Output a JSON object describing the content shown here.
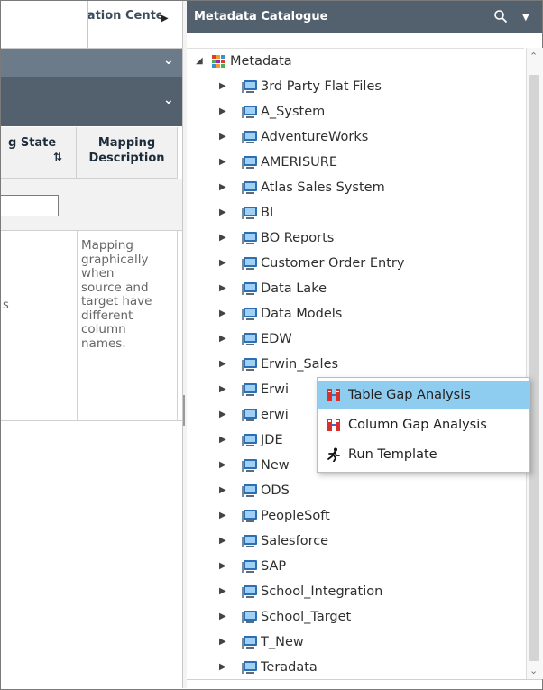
{
  "left_panel": {
    "tab_label": "Collaboration Center",
    "columns": [
      {
        "label_line1": "g State",
        "label_line2": ""
      },
      {
        "label_line1": "Mapping",
        "label_line2": "Description"
      }
    ],
    "row_fragment": "s",
    "row_description_lines": [
      "Mapping",
      "graphically",
      "when",
      "source and",
      "target have",
      "different",
      "column",
      "names."
    ]
  },
  "right_panel": {
    "title": "Metadata Catalogue",
    "root": "Metadata",
    "items": [
      "3rd Party Flat Files",
      "A_System",
      "AdventureWorks",
      "AMERISURE",
      "Atlas Sales System",
      "BI",
      "BO Reports",
      "Customer Order Entry",
      "Data Lake",
      "Data Models",
      "EDW",
      "Erwin_Sales",
      "Erwi",
      "erwi",
      "JDE",
      "New",
      "ODS",
      "PeopleSoft",
      "Salesforce",
      "SAP",
      "School_Integration",
      "School_Target",
      "T_New",
      "Teradata"
    ]
  },
  "context_menu": {
    "items": [
      {
        "label": "Table Gap Analysis",
        "icon": "gap-analysis-icon"
      },
      {
        "label": "Column Gap Analysis",
        "icon": "gap-analysis-icon"
      },
      {
        "label": "Run Template",
        "icon": "run-icon"
      }
    ],
    "highlighted_index": 0
  },
  "colors": {
    "header_dark": "#53616f",
    "header_light": "#6b7b8a",
    "highlight": "#8fcdf0"
  }
}
